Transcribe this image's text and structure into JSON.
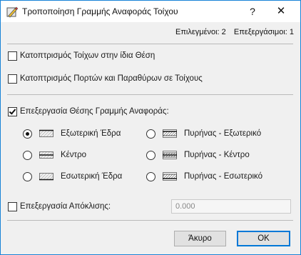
{
  "window": {
    "title": "Τροποποίηση Γραμμής Αναφοράς Τοίχου",
    "help": "?",
    "close": "✕"
  },
  "counts": {
    "selected": "Επιλεγμένοι: 2",
    "editable": "Επεξεργάσιμοι: 1"
  },
  "options": {
    "mirror_walls": {
      "label": "Κατοπτρισμός Τοίχων στην ίδια Θέση",
      "checked": false
    },
    "mirror_openings": {
      "label": "Κατοπτρισμός Πορτών και Παραθύρων σε Τοίχους",
      "checked": false
    },
    "edit_position": {
      "label": "Επεξεργασία Θέσης Γραμμής Αναφοράς:",
      "checked": true
    },
    "edit_offset": {
      "label": "Επεξεργασία Απόκλισης:",
      "checked": false
    }
  },
  "positions": {
    "exterior_face": {
      "label": "Εξωτερική Έδρα",
      "selected": true
    },
    "center": {
      "label": "Κέντρο",
      "selected": false
    },
    "interior_face": {
      "label": "Εσωτερική Έδρα",
      "selected": false
    },
    "core_exterior": {
      "label": "Πυρήνας - Εξωτερικό",
      "selected": false
    },
    "core_center": {
      "label": "Πυρήνας - Κέντρο",
      "selected": false
    },
    "core_interior": {
      "label": "Πυρήνας - Εσωτερικό",
      "selected": false
    }
  },
  "offset": {
    "value": "0.000"
  },
  "buttons": {
    "cancel": "Άκυρο",
    "ok": "OK"
  },
  "colors": {
    "accent": "#0078d7",
    "window_border": "#1883d7"
  }
}
